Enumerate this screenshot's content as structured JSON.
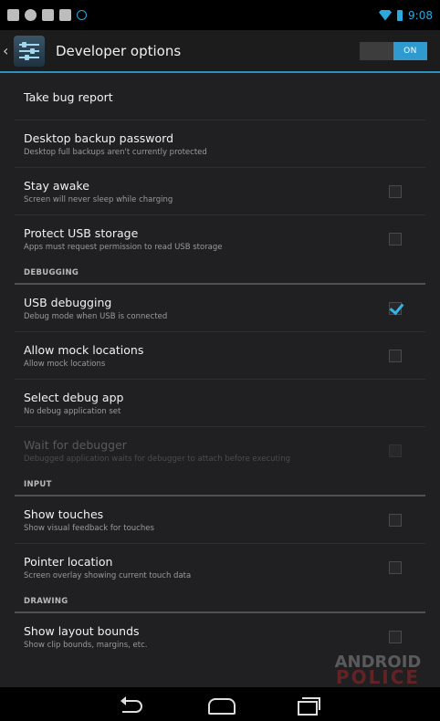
{
  "status_bar": {
    "time": "9:08",
    "notification_icons": [
      "gamepad-icon",
      "settings-icon",
      "image-icon",
      "gmail-icon",
      "play-music-icon"
    ]
  },
  "action_bar": {
    "title": "Developer options",
    "toggle_label": "ON",
    "toggle_state": "on"
  },
  "settings": [
    {
      "title": "Take bug report",
      "summary": null,
      "checkbox": null
    },
    {
      "title": "Desktop backup password",
      "summary": "Desktop full backups aren't currently protected",
      "checkbox": null
    },
    {
      "title": "Stay awake",
      "summary": "Screen will never sleep while charging",
      "checkbox": false
    },
    {
      "title": "Protect USB storage",
      "summary": "Apps must request permission to read USB storage",
      "checkbox": false
    }
  ],
  "sections": {
    "debugging": {
      "header": "DEBUGGING",
      "items": [
        {
          "title": "USB debugging",
          "summary": "Debug mode when USB is connected",
          "checkbox": true
        },
        {
          "title": "Allow mock locations",
          "summary": "Allow mock locations",
          "checkbox": false
        },
        {
          "title": "Select debug app",
          "summary": "No debug application set",
          "checkbox": null
        },
        {
          "title": "Wait for debugger",
          "summary": "Debugged application waits for debugger to attach before executing",
          "checkbox": false,
          "disabled": true
        }
      ]
    },
    "input": {
      "header": "INPUT",
      "items": [
        {
          "title": "Show touches",
          "summary": "Show visual feedback for touches",
          "checkbox": false
        },
        {
          "title": "Pointer location",
          "summary": "Screen overlay showing current touch data",
          "checkbox": false
        }
      ]
    },
    "drawing": {
      "header": "DRAWING",
      "items": [
        {
          "title": "Show layout bounds",
          "summary": "Show clip bounds, margins, etc.",
          "checkbox": false
        }
      ]
    }
  },
  "watermark": {
    "line1": "ANDROID",
    "line2": "POLICE"
  },
  "colors": {
    "accent": "#33b5e5",
    "background": "#202022"
  }
}
